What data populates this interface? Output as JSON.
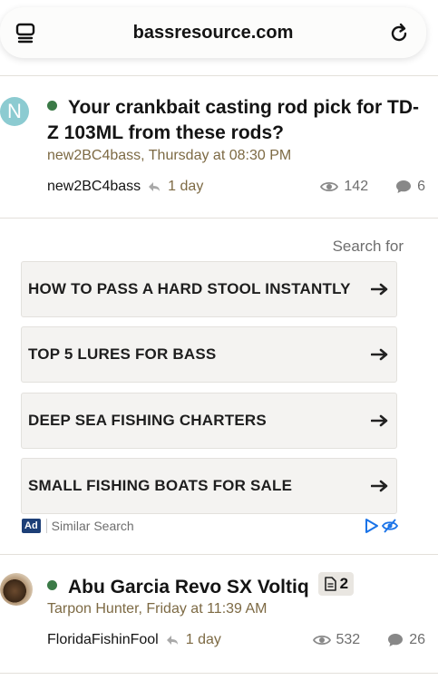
{
  "browser": {
    "domain": "bassresource.com"
  },
  "threads": [
    {
      "avatar_letter": "N",
      "title": "Your crankbait casting rod pick for TD-Z 103ML from these rods?",
      "author": "new2BC4bass",
      "date": "Thursday at 08:30 PM",
      "meta": "new2BC4bass, Thursday at 08:30 PM",
      "last_poster": "new2BC4bass",
      "last_age": "1 day",
      "views": "142",
      "replies": "6"
    },
    {
      "title": "Abu Garcia Revo SX Voltiq",
      "pages_badge": "2",
      "meta": "Tarpon Hunter, Friday at 11:39 AM",
      "last_poster": "FloridaFishinFool",
      "last_age": "1 day",
      "views": "532",
      "replies": "26"
    }
  ],
  "ad": {
    "search_for": "Search for",
    "items": [
      "HOW TO PASS A HARD STOOL INSTANTLY",
      "TOP 5 LURES FOR BASS",
      "DEEP SEA FISHING CHARTERS",
      "SMALL FISHING BOATS FOR SALE"
    ],
    "ad_label": "Ad",
    "similar": "Similar Search"
  },
  "colors": {
    "online_dot": "#3b7a47",
    "meta_text": "#7d6a44",
    "ad_tag": "#1d3f77",
    "ad_icon": "#1a73e8"
  }
}
